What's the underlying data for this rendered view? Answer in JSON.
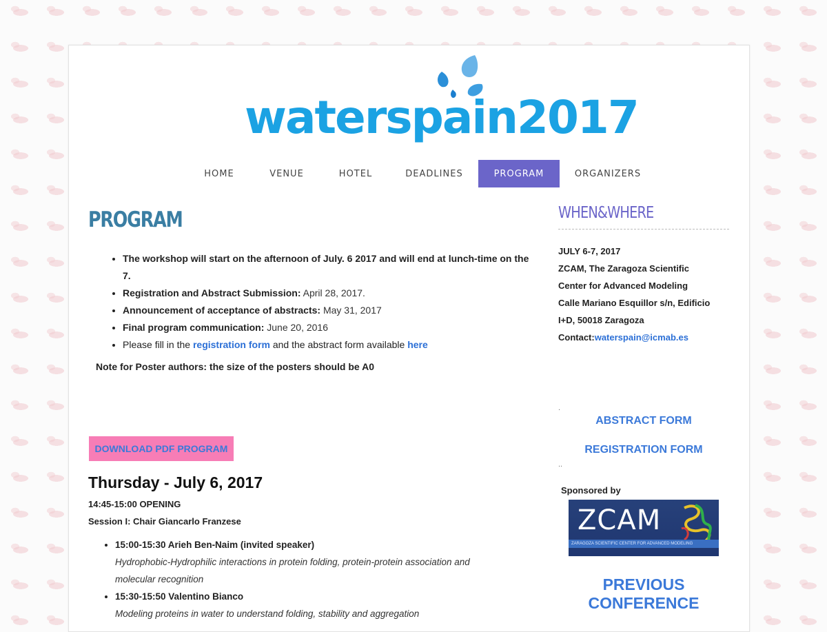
{
  "logo": {
    "text": "waterspain2017"
  },
  "nav": {
    "items": [
      {
        "label": "HOME"
      },
      {
        "label": "VENUE"
      },
      {
        "label": "HOTEL"
      },
      {
        "label": "DEADLINES"
      },
      {
        "label": "PROGRAM",
        "active": true
      },
      {
        "label": "ORGANIZERS"
      }
    ]
  },
  "main": {
    "title": "PROGRAM",
    "bullets": [
      {
        "bold": "The workshop will start on the afternoon of July. 6 2017 and will end at lunch-time on the 7.",
        "value": ""
      },
      {
        "bold": "Registration and Abstract Submission:",
        "value": " April 28, 2017."
      },
      {
        "bold": "Announcement of acceptance of abstracts:",
        "value": " May 31, 2017"
      },
      {
        "bold": "Final program communication:",
        "value": " June 20, 2016"
      }
    ],
    "fill_line": {
      "prefix": "Please fill in the ",
      "link1": "registration form",
      "middle": " and the abstract form available ",
      "link2": "here"
    },
    "note": "Note for Poster authors: the size of the posters should be A0",
    "pdf_button": "DOWNLOAD PDF PROGRAM",
    "day_title": "Thursday - July 6, 2017",
    "opening": "14:45-15:00 OPENING",
    "session": "Session I: Chair Giancarlo Franzese",
    "talks": [
      {
        "speaker": "15:00-15:30 Arieh Ben-Naim (invited speaker)",
        "title": "Hydrophobic-Hydrophilic interactions in protein folding, protein-protein association and molecular recognition"
      },
      {
        "speaker": "15:30-15:50 Valentino Bianco",
        "title": "Modeling proteins in water to understand folding, stability and aggregation"
      }
    ]
  },
  "sidebar": {
    "title": "WHEN&WHERE",
    "lines": [
      "JULY 6-7, 2017",
      "ZCAM, The Zaragoza Scientific",
      "Center for Advanced Modeling",
      "Calle Mariano Esquillor s/n, Edificio",
      "I+D, 50018 Zaragoza"
    ],
    "contact_label": "Contact:",
    "contact_email": "waterspain@icmab.es",
    "dot1": ".",
    "abstract_form": "ABSTRACT FORM",
    "registration_form": "REGISTRATION FORM",
    "dot2": "..",
    "sponsored_by": "Sponsored by",
    "sponsor_logo": "ZCAM",
    "sponsor_tagline": "ZARAGOZA SCIENTIFIC CENTER FOR ADVANCED MODELING",
    "previous_line1": "PREVIOUS",
    "previous_line2": "CONFERENCE"
  },
  "colors": {
    "logo_blue": "#1ba2e3",
    "nav_active": "#6b65c9",
    "title_blue": "#3a7ea3",
    "link_blue": "#2b6fd6",
    "pdf_button_bg": "#f77db6"
  }
}
